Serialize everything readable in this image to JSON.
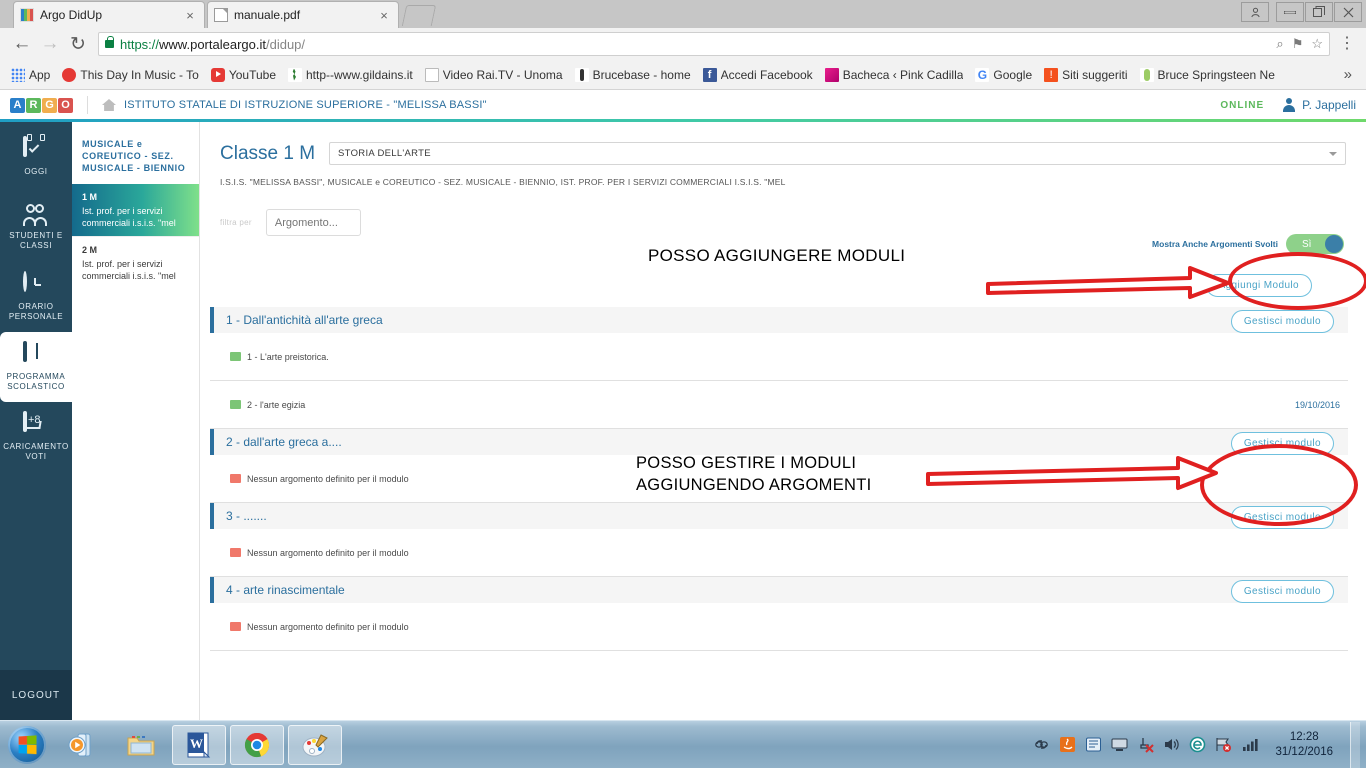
{
  "browser": {
    "tabs": [
      {
        "title": "Argo DidUp",
        "favicon": "argo-favicon",
        "close": "×"
      },
      {
        "title": "manuale.pdf",
        "favicon": "pdf-favicon",
        "close": "×"
      }
    ],
    "window_controls": {
      "user": "὆4",
      "minimize": "–",
      "maximize": "❐",
      "close": "✕"
    },
    "nav": {
      "back": "←",
      "forward": "→",
      "reload": "↻"
    },
    "omnibox": {
      "scheme": "https://",
      "host": "www.portaleargo.it",
      "path": "/didup/",
      "search_icon": "⌕",
      "save_icon": "⚑",
      "star_icon": "☆",
      "menu_icon": "⋮"
    },
    "bookmarks": {
      "apps_label": "App",
      "items": [
        {
          "label": "This Day In Music - To",
          "icon": "red-dot-icon"
        },
        {
          "label": "YouTube",
          "icon": "youtube-icon"
        },
        {
          "label": "http--www.gildains.it",
          "icon": "gilda-icon"
        },
        {
          "label": "Video Rai.TV - Unoma",
          "icon": "document-icon"
        },
        {
          "label": "Brucebase - home",
          "icon": "person-icon"
        },
        {
          "label": "Accedi  Facebook",
          "icon": "facebook-icon"
        },
        {
          "label": "Bacheca ‹ Pink Cadilla",
          "icon": "pink-cadillac-icon"
        },
        {
          "label": "Google",
          "icon": "google-icon"
        },
        {
          "label": "Siti suggeriti",
          "icon": "suggested-sites-icon"
        },
        {
          "label": "Bruce Springsteen  Ne",
          "icon": "springsteen-icon"
        }
      ],
      "overflow": "»"
    }
  },
  "app": {
    "logo_letters": [
      "A",
      "R",
      "G",
      "O"
    ],
    "school_name": "ISTITUTO STATALE DI ISTRUZIONE SUPERIORE - \"MELISSA BASSI\"",
    "status": "ONLINE",
    "user": "P. Jappelli",
    "accent": "#2b6f9e"
  },
  "sidebar": {
    "items": [
      {
        "label": "OGGI",
        "icon": "calendar-check-icon",
        "active": false
      },
      {
        "label": "STUDENTI E CLASSI",
        "icon": "people-icon",
        "active": false
      },
      {
        "label": "ORARIO PERSONALE",
        "icon": "clock-icon",
        "active": false
      },
      {
        "label": "PROGRAMMA SCOLASTICO",
        "icon": "book-icon",
        "active": true
      },
      {
        "label": "CARICAMENTO VOTI",
        "icon": "upload-grades-icon",
        "active": false
      }
    ],
    "logout": "LOGOUT"
  },
  "classlist": {
    "group_title": "MUSICALE e COREUTICO - SEZ. MUSICALE - BIENNIO",
    "items": [
      {
        "code": "1 M",
        "desc": "Ist. prof. per i servizi commerciali i.s.i.s. \"mel",
        "selected": true
      },
      {
        "code": "2 M",
        "desc": "Ist. prof. per i servizi commerciali i.s.i.s. \"mel",
        "selected": false
      }
    ]
  },
  "main": {
    "classe_title": "Classe 1 M",
    "subject_selected": "STORIA DELL'ARTE",
    "school_line": "I.S.I.S. \"MELISSA BASSI\", MUSICALE e COREUTICO - SEZ. MUSICALE - BIENNIO, IST. PROF. PER I SERVIZI COMMERCIALI I.S.I.S. \"MEL",
    "filter_label": "filtra per",
    "filter_placeholder": "Argomento...",
    "toggle_label": "Mostra Anche Argomenti Svolti",
    "toggle_value": "Sì",
    "toggle_color": "#8ed18a",
    "add_module_label": "Aggiungi Modulo",
    "manage_module_label": "Gestisci modulo",
    "empty_topic_text": "Nessun argomento definito per il modulo",
    "modules": [
      {
        "title": "1 - Dall'antichità all'arte greca",
        "button": "Gestisci modulo",
        "topics": [
          {
            "text": "1 - L'arte preistorica.",
            "status": "green",
            "date": ""
          },
          {
            "text": "2 - l'arte egizia",
            "status": "green",
            "date": "19/10/2016"
          }
        ]
      },
      {
        "title": "2 - dall'arte greca a....",
        "button": "Gestisci modulo",
        "topics": [
          {
            "text": "Nessun argomento definito per il modulo",
            "status": "red",
            "date": ""
          }
        ]
      },
      {
        "title": "3 - .......",
        "button": "Gestisci modulo",
        "topics": [
          {
            "text": "Nessun argomento definito per il modulo",
            "status": "red",
            "date": ""
          }
        ]
      },
      {
        "title": "4 - arte rinascimentale",
        "button": "Gestisci modulo",
        "topics": [
          {
            "text": "Nessun argomento definito per il modulo",
            "status": "red",
            "date": ""
          }
        ]
      }
    ]
  },
  "annotations": {
    "color": "#e02020",
    "note_1": "POSSO AGGIUNGERE MODULI",
    "note_2": "POSSO GESTIRE I MODULI\nAGGIUNGENDO ARGOMENTI"
  },
  "taskbar": {
    "start": "windows-start-orb",
    "items": [
      {
        "name": "windows-media-player-icon",
        "open": false
      },
      {
        "name": "file-explorer-icon",
        "open": false
      },
      {
        "name": "microsoft-word-icon",
        "open": true
      },
      {
        "name": "google-chrome-icon",
        "open": true
      },
      {
        "name": "paint-icon",
        "open": true
      }
    ],
    "tray": [
      "link-icon",
      "java-icon",
      "network-drive-icon",
      "display-icon",
      "usb-eject-icon",
      "volume-icon",
      "internet-explorer-icon",
      "action-center-flag-icon",
      "signal-bars-icon"
    ],
    "time": "12:28",
    "date": "31/12/2016"
  }
}
